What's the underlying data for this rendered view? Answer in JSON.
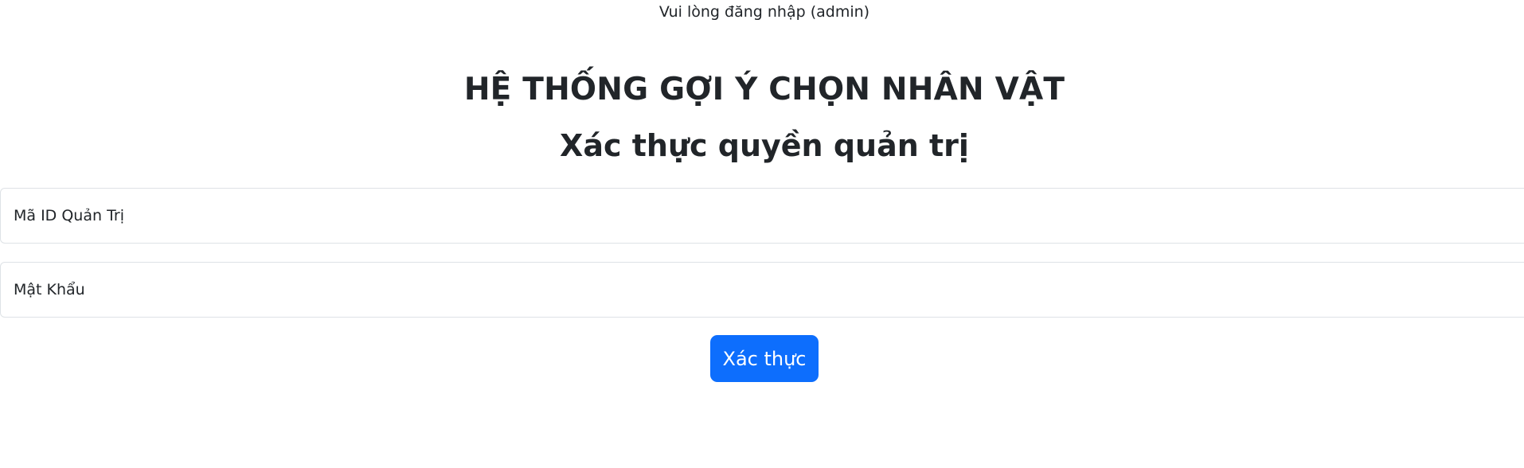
{
  "notice": {
    "text": "Vui lòng đăng nhập (admin)"
  },
  "header": {
    "title": "HỆ THỐNG GỢI Ý CHỌN NHÂN VẬT",
    "subtitle": "Xác thực quyền quản trị"
  },
  "form": {
    "admin_id": {
      "placeholder": "Mã ID Quản Trị",
      "value": ""
    },
    "password": {
      "placeholder": "Mật Khẩu",
      "value": ""
    },
    "submit_label": "Xác thực"
  },
  "colors": {
    "primary_button": "#0d6efd",
    "text": "#212529",
    "input_border": "#dee2e6"
  }
}
